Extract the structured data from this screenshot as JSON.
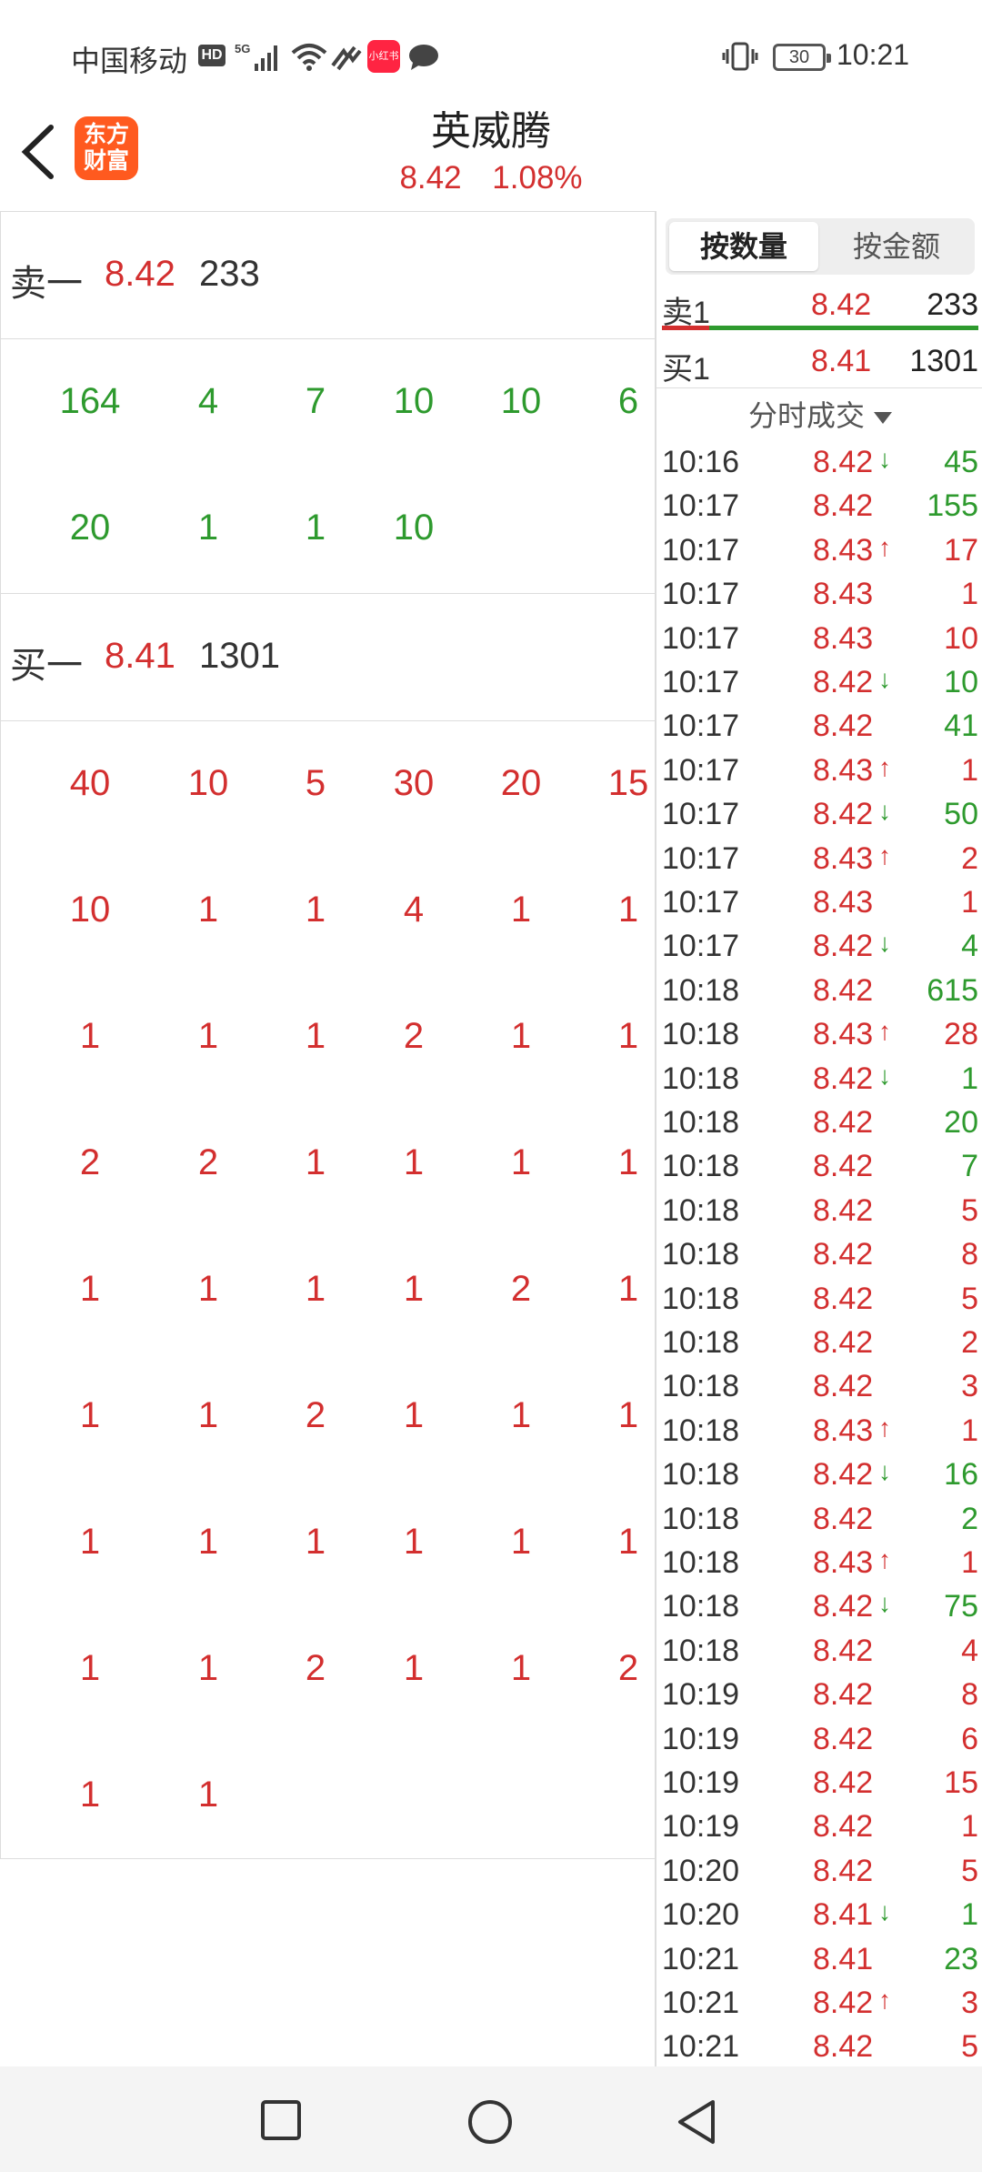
{
  "status_bar": {
    "carrier": "中国移动",
    "hd": "HD",
    "app_badge": "小红书",
    "battery": "30",
    "time": "10:21"
  },
  "header": {
    "logo_line1": "东方",
    "logo_line2": "财富",
    "title": "英威腾",
    "price": "8.42",
    "change_pct": "1.08%"
  },
  "left": {
    "sell1": {
      "label": "卖一",
      "price": "8.42",
      "qty": "233"
    },
    "sell_queue": [
      [
        "164",
        "4",
        "7",
        "10",
        "10",
        "6"
      ],
      [
        "20",
        "1",
        "1",
        "10"
      ]
    ],
    "buy1": {
      "label": "买一",
      "price": "8.41",
      "qty": "1301"
    },
    "buy_queue": [
      [
        "40",
        "10",
        "5",
        "30",
        "20",
        "15"
      ],
      [
        "10",
        "1",
        "1",
        "4",
        "1",
        "1"
      ],
      [
        "1",
        "1",
        "1",
        "2",
        "1",
        "1"
      ],
      [
        "2",
        "2",
        "1",
        "1",
        "1",
        "1"
      ],
      [
        "1",
        "1",
        "1",
        "1",
        "2",
        "1"
      ],
      [
        "1",
        "1",
        "2",
        "1",
        "1",
        "1"
      ],
      [
        "1",
        "1",
        "1",
        "1",
        "1",
        "1"
      ],
      [
        "1",
        "1",
        "2",
        "1",
        "1",
        "2"
      ],
      [
        "1",
        "1"
      ]
    ]
  },
  "right": {
    "tabs": [
      "按数量",
      "按金额"
    ],
    "ask": {
      "label": "卖1",
      "price": "8.42",
      "vol": "233"
    },
    "bid": {
      "label": "买1",
      "price": "8.41",
      "vol": "1301"
    },
    "bid_share": 0.15,
    "ticks_title": "分时成交",
    "ticks": [
      {
        "t": "10:16",
        "p": "8.42",
        "d": "down",
        "v": "45",
        "c": "green"
      },
      {
        "t": "10:17",
        "p": "8.42",
        "d": "",
        "v": "155",
        "c": "green"
      },
      {
        "t": "10:17",
        "p": "8.43",
        "d": "up",
        "v": "17",
        "c": "red"
      },
      {
        "t": "10:17",
        "p": "8.43",
        "d": "",
        "v": "1",
        "c": "red"
      },
      {
        "t": "10:17",
        "p": "8.43",
        "d": "",
        "v": "10",
        "c": "red"
      },
      {
        "t": "10:17",
        "p": "8.42",
        "d": "down",
        "v": "10",
        "c": "green"
      },
      {
        "t": "10:17",
        "p": "8.42",
        "d": "",
        "v": "41",
        "c": "green"
      },
      {
        "t": "10:17",
        "p": "8.43",
        "d": "up",
        "v": "1",
        "c": "red"
      },
      {
        "t": "10:17",
        "p": "8.42",
        "d": "down",
        "v": "50",
        "c": "green"
      },
      {
        "t": "10:17",
        "p": "8.43",
        "d": "up",
        "v": "2",
        "c": "red"
      },
      {
        "t": "10:17",
        "p": "8.43",
        "d": "",
        "v": "1",
        "c": "red"
      },
      {
        "t": "10:17",
        "p": "8.42",
        "d": "down",
        "v": "4",
        "c": "green"
      },
      {
        "t": "10:18",
        "p": "8.42",
        "d": "",
        "v": "615",
        "c": "green"
      },
      {
        "t": "10:18",
        "p": "8.43",
        "d": "up",
        "v": "28",
        "c": "red"
      },
      {
        "t": "10:18",
        "p": "8.42",
        "d": "down",
        "v": "1",
        "c": "green"
      },
      {
        "t": "10:18",
        "p": "8.42",
        "d": "",
        "v": "20",
        "c": "green"
      },
      {
        "t": "10:18",
        "p": "8.42",
        "d": "",
        "v": "7",
        "c": "green"
      },
      {
        "t": "10:18",
        "p": "8.42",
        "d": "",
        "v": "5",
        "c": "red"
      },
      {
        "t": "10:18",
        "p": "8.42",
        "d": "",
        "v": "8",
        "c": "red"
      },
      {
        "t": "10:18",
        "p": "8.42",
        "d": "",
        "v": "5",
        "c": "red"
      },
      {
        "t": "10:18",
        "p": "8.42",
        "d": "",
        "v": "2",
        "c": "red"
      },
      {
        "t": "10:18",
        "p": "8.42",
        "d": "",
        "v": "3",
        "c": "red"
      },
      {
        "t": "10:18",
        "p": "8.43",
        "d": "up",
        "v": "1",
        "c": "red"
      },
      {
        "t": "10:18",
        "p": "8.42",
        "d": "down",
        "v": "16",
        "c": "green"
      },
      {
        "t": "10:18",
        "p": "8.42",
        "d": "",
        "v": "2",
        "c": "green"
      },
      {
        "t": "10:18",
        "p": "8.43",
        "d": "up",
        "v": "1",
        "c": "red"
      },
      {
        "t": "10:18",
        "p": "8.42",
        "d": "down",
        "v": "75",
        "c": "green"
      },
      {
        "t": "10:18",
        "p": "8.42",
        "d": "",
        "v": "4",
        "c": "red"
      },
      {
        "t": "10:19",
        "p": "8.42",
        "d": "",
        "v": "8",
        "c": "red"
      },
      {
        "t": "10:19",
        "p": "8.42",
        "d": "",
        "v": "6",
        "c": "red"
      },
      {
        "t": "10:19",
        "p": "8.42",
        "d": "",
        "v": "15",
        "c": "red"
      },
      {
        "t": "10:19",
        "p": "8.42",
        "d": "",
        "v": "1",
        "c": "red"
      },
      {
        "t": "10:20",
        "p": "8.42",
        "d": "",
        "v": "5",
        "c": "red"
      },
      {
        "t": "10:20",
        "p": "8.41",
        "d": "down",
        "v": "1",
        "c": "green"
      },
      {
        "t": "10:21",
        "p": "8.41",
        "d": "",
        "v": "23",
        "c": "green"
      },
      {
        "t": "10:21",
        "p": "8.42",
        "d": "up",
        "v": "3",
        "c": "red"
      },
      {
        "t": "10:21",
        "p": "8.42",
        "d": "",
        "v": "5",
        "c": "red"
      }
    ]
  },
  "colors": {
    "up": "#d32f2f",
    "down": "#2e9a2e",
    "brand": "#ff5a1f"
  },
  "icons": {
    "back": "back-arrow-icon",
    "nav": [
      "recent-apps-icon",
      "home-icon",
      "back-icon"
    ]
  }
}
